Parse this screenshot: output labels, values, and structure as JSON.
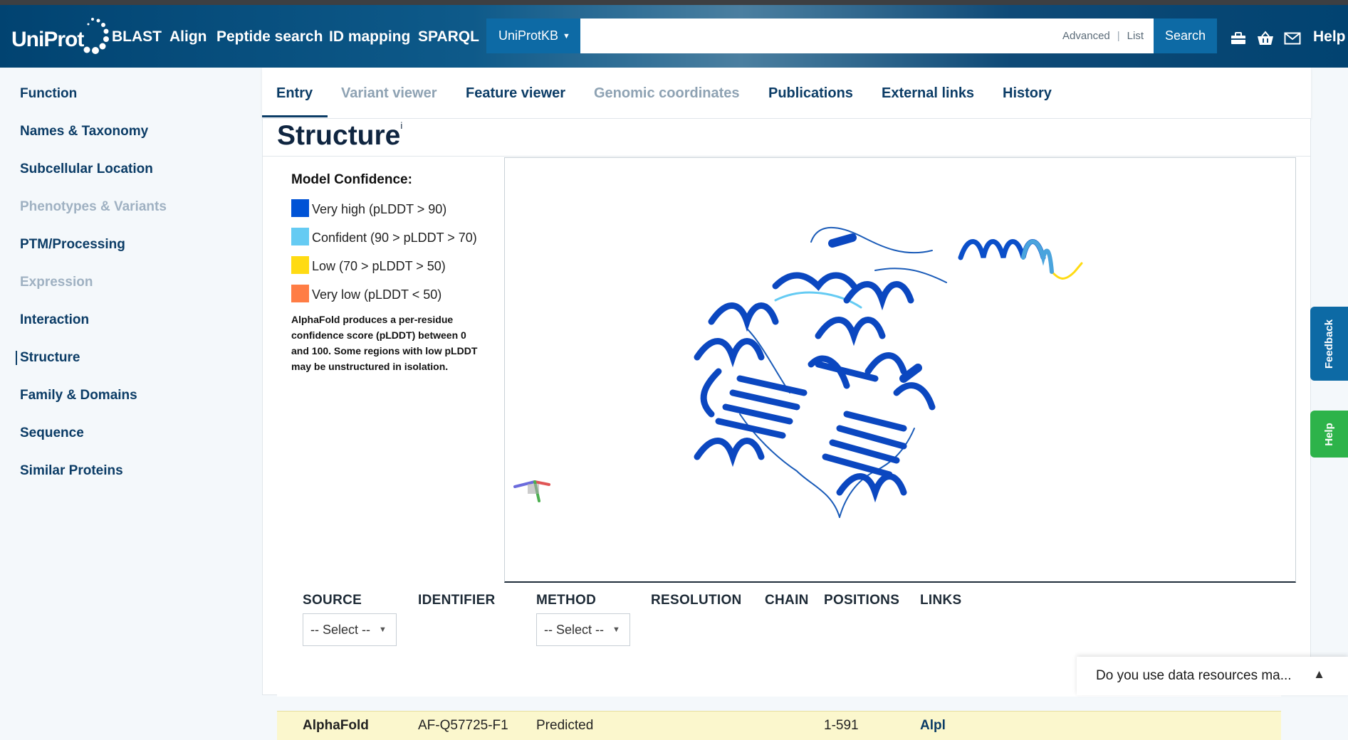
{
  "header": {
    "logo_text": "UniProt",
    "nav": [
      "BLAST",
      "Align",
      "Peptide search",
      "ID mapping",
      "SPARQL"
    ],
    "database_select": "UniProtKB",
    "search_placeholder": "",
    "advanced_link": "Advanced",
    "list_link": "List",
    "search_button": "Search",
    "icons": [
      "tools-icon",
      "basket-icon",
      "mail-icon"
    ],
    "help_label": "Help"
  },
  "sidebar": {
    "items": [
      {
        "label": "Function",
        "state": "enabled"
      },
      {
        "label": "Names & Taxonomy",
        "state": "enabled"
      },
      {
        "label": "Subcellular Location",
        "state": "enabled"
      },
      {
        "label": "Phenotypes & Variants",
        "state": "disabled"
      },
      {
        "label": "PTM/Processing",
        "state": "enabled"
      },
      {
        "label": "Expression",
        "state": "disabled"
      },
      {
        "label": "Interaction",
        "state": "enabled"
      },
      {
        "label": "Structure",
        "state": "active"
      },
      {
        "label": "Family & Domains",
        "state": "enabled"
      },
      {
        "label": "Sequence",
        "state": "enabled"
      },
      {
        "label": "Similar Proteins",
        "state": "enabled"
      }
    ]
  },
  "tabs": [
    {
      "label": "Entry",
      "state": "active"
    },
    {
      "label": "Variant viewer",
      "state": "disabled"
    },
    {
      "label": "Feature viewer",
      "state": "enabled"
    },
    {
      "label": "Genomic coordinates",
      "state": "disabled"
    },
    {
      "label": "Publications",
      "state": "enabled"
    },
    {
      "label": "External links",
      "state": "enabled"
    },
    {
      "label": "History",
      "state": "enabled"
    }
  ],
  "structure": {
    "title": "Structure",
    "info_mark": "i",
    "legend_title": "Model Confidence:",
    "legend": [
      {
        "label": "Very high (pLDDT > 90)",
        "color": "#0053d6"
      },
      {
        "label": "Confident (90 > pLDDT > 70)",
        "color": "#65cbf3"
      },
      {
        "label": "Low (70 > pLDDT > 50)",
        "color": "#ffdb13"
      },
      {
        "label": "Very low (pLDDT < 50)",
        "color": "#ff7d45"
      }
    ],
    "note": "AlphaFold produces a per-residue confidence score (pLDDT) between 0 and 100. Some regions with low pLDDT may be unstructured in isolation."
  },
  "table": {
    "headers": [
      "SOURCE",
      "IDENTIFIER",
      "METHOD",
      "RESOLUTION",
      "CHAIN",
      "POSITIONS",
      "LINKS"
    ],
    "source_filter": "-- Select --",
    "method_filter": "-- Select --",
    "rows": [
      {
        "source": "AlphaFold",
        "identifier": "AF-Q57725-F1",
        "method": "Predicted",
        "resolution": "",
        "chain": "",
        "positions": "1-591",
        "links": "Alpl"
      }
    ]
  },
  "side_buttons": {
    "feedback": "Feedback",
    "help": "Help"
  },
  "survey": {
    "text": "Do you use data resources ma..."
  }
}
